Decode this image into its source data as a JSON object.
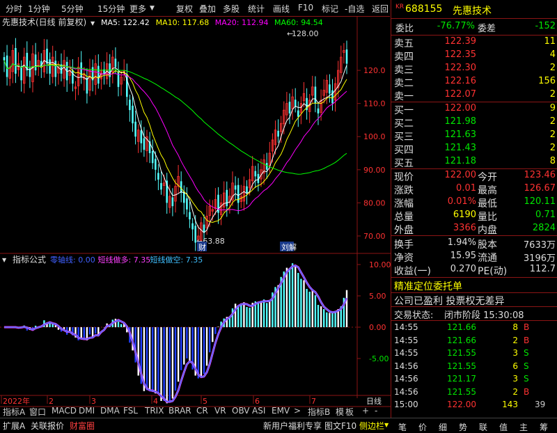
{
  "toolbar": {
    "left": [
      "分时",
      "1分钟",
      "5分钟",
      "15分钟",
      "更多"
    ],
    "right": [
      "复权",
      "叠加",
      "多股",
      "统计",
      "画线",
      "F10",
      "标记",
      "-自选",
      "返回"
    ]
  },
  "chart": {
    "title": "先惠技术(日线 前复权)",
    "ma_labels": [
      {
        "t": "MA5: 122.42",
        "c": "#ffffff"
      },
      {
        "t": "MA10: 117.68",
        "c": "#ffff00"
      },
      {
        "t": "MA20: 112.94",
        "c": "#ff00ff"
      },
      {
        "t": "MA60: 94.54",
        "c": "#00ff00"
      }
    ],
    "y_ticks": [
      "120.0",
      "110.0",
      "100.0",
      "90.00",
      "80.00",
      "70.00"
    ],
    "high_label": "128.00",
    "low_label": "63.88",
    "event_labels": [
      "财",
      "解"
    ]
  },
  "indicator": {
    "name": "指标公式",
    "labels": [
      {
        "t": "零轴线: 0.00",
        "c": "#4060ff"
      },
      {
        "t": "短线做多: 7.35",
        "c": "#ff40ff"
      },
      {
        "t": "短线做空: 7.35",
        "c": "#40c0ff"
      }
    ],
    "y_ticks": [
      "10.00",
      "5.00",
      "0.00",
      "-5.00"
    ]
  },
  "x_axis": [
    "2022年",
    "2",
    "3",
    "4",
    "5",
    "6",
    "7"
  ],
  "x_unit": "日线",
  "tabs": [
    "指标A",
    "窗口",
    "MACD",
    "DMI",
    "DMA",
    "FSL",
    "TRIX",
    "BRAR",
    "CR",
    "VR",
    "OBV",
    "ASI",
    "EMV",
    ">",
    "指标B",
    "模",
    "板",
    "+",
    "-"
  ],
  "bottom": {
    "left": [
      "扩展A",
      "关联报价",
      "财富圈"
    ],
    "mid": [
      "新用户福利专享",
      "图文F10",
      "侧边栏"
    ],
    "right": [
      "笔",
      "价",
      "细",
      "势",
      "联",
      "值",
      "主",
      "筹"
    ]
  },
  "quote": {
    "code": "688155",
    "name": "先惠技术",
    "market_tag": "KR",
    "webi_label": "委比",
    "webi": "-76.77%",
    "weicha_label": "委差",
    "weicha": "-152",
    "asks": [
      {
        "l": "卖五",
        "p": "122.39",
        "v": "11"
      },
      {
        "l": "卖四",
        "p": "122.35",
        "v": "4"
      },
      {
        "l": "卖三",
        "p": "122.30",
        "v": "2"
      },
      {
        "l": "卖二",
        "p": "122.16",
        "v": "156"
      },
      {
        "l": "卖一",
        "p": "122.07",
        "v": "2"
      }
    ],
    "bids": [
      {
        "l": "买一",
        "p": "122.00",
        "v": "9"
      },
      {
        "l": "买二",
        "p": "121.98",
        "v": "2"
      },
      {
        "l": "买三",
        "p": "121.63",
        "v": "2"
      },
      {
        "l": "买四",
        "p": "121.43",
        "v": "2"
      },
      {
        "l": "买五",
        "p": "121.18",
        "v": "8"
      }
    ],
    "stats": [
      {
        "l1": "现价",
        "v1": "122.00",
        "c1": "#ff3232",
        "l2": "今开",
        "v2": "123.46",
        "c2": "#ff3232"
      },
      {
        "l1": "涨跌",
        "v1": "0.01",
        "c1": "#ff3232",
        "l2": "最高",
        "v2": "126.67",
        "c2": "#ff3232"
      },
      {
        "l1": "涨幅",
        "v1": "0.01%",
        "c1": "#ff3232",
        "l2": "最低",
        "v2": "120.11",
        "c2": "#00e600"
      },
      {
        "l1": "总量",
        "v1": "6190",
        "c1": "#ffff00",
        "l2": "量比",
        "v2": "0.71",
        "c2": "#00e600"
      },
      {
        "l1": "外盘",
        "v1": "3366",
        "c1": "#ff3232",
        "l2": "内盘",
        "v2": "2824",
        "c2": "#00e600"
      }
    ],
    "fin": [
      {
        "l1": "换手",
        "v1": "1.94%",
        "l2": "股本",
        "v2": "7633万"
      },
      {
        "l1": "净资",
        "v1": "15.95",
        "l2": "流通",
        "v2": "3196万"
      },
      {
        "l1": "收益(一)",
        "v1": "0.270",
        "l2": "PE(动)",
        "v2": "112.7"
      }
    ],
    "notice1": "精准定位委托单",
    "notice2": "公司已盈利 投票权无差异",
    "trade_status_label": "交易状态:",
    "trade_status": "闭市阶段 15:30:08",
    "ticks": [
      {
        "t": "14:55",
        "p": "121.66",
        "v": "8",
        "s": "B"
      },
      {
        "t": "14:55",
        "p": "121.66",
        "v": "2",
        "s": "B"
      },
      {
        "t": "14:55",
        "p": "121.55",
        "v": "3",
        "s": "S"
      },
      {
        "t": "14:56",
        "p": "121.55",
        "v": "6",
        "s": "S"
      },
      {
        "t": "14:56",
        "p": "121.17",
        "v": "3",
        "s": "S"
      },
      {
        "t": "14:56",
        "p": "121.55",
        "v": "2",
        "s": "B"
      },
      {
        "t": "15:00",
        "p": "122.00",
        "v": "143",
        "s": "39"
      }
    ]
  }
}
